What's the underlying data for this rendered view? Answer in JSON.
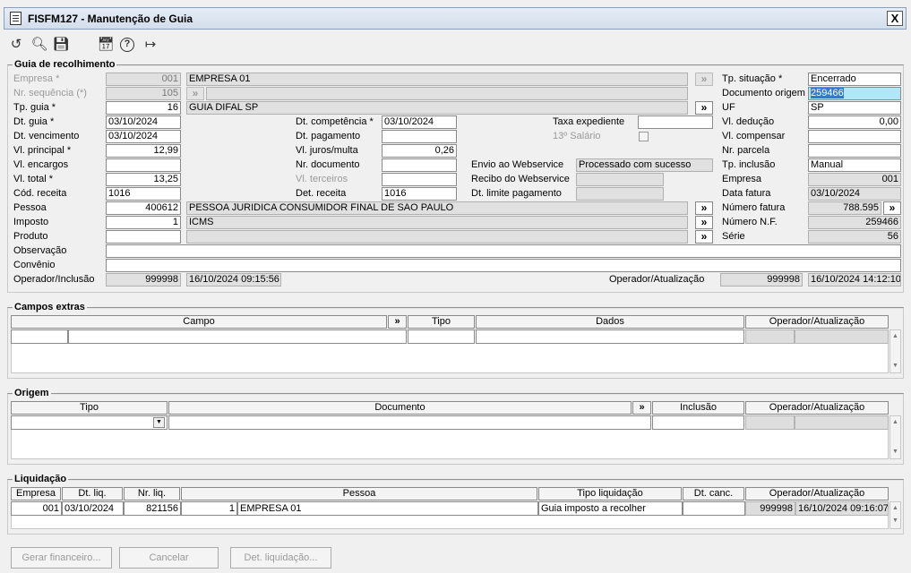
{
  "window": {
    "title": "FISFM127 - Manutenção de Guia",
    "close_label": "X"
  },
  "toolbar": {
    "undo": "↺",
    "search": "🔍︎",
    "save": "💾︎",
    "calendar": "📅︎",
    "help": "?",
    "exit": "↦"
  },
  "guia": {
    "legend": "Guia de recolhimento",
    "empresa": {
      "label": "Empresa *",
      "code": "001",
      "name": "EMPRESA 01"
    },
    "nr_sequencia": {
      "label": "Nr. sequência (*)",
      "value": "105"
    },
    "tp_guia": {
      "label": "Tp. guia *",
      "code": "16",
      "name": "GUIA DIFAL SP"
    },
    "dt_guia": {
      "label": "Dt. guia *",
      "value": "03/10/2024"
    },
    "dt_vencimento": {
      "label": "Dt. vencimento",
      "value": "03/10/2024"
    },
    "vl_principal": {
      "label": "Vl. principal *",
      "value": "12,99"
    },
    "vl_encargos": {
      "label": "Vl. encargos",
      "value": ""
    },
    "vl_total": {
      "label": "Vl. total *",
      "value": "13,25"
    },
    "cod_receita": {
      "label": "Cód. receita",
      "value": "1016"
    },
    "pessoa": {
      "label": "Pessoa",
      "code": "400612",
      "name": "PESSOA JURIDICA CONSUMIDOR FINAL DE SAO PAULO"
    },
    "imposto": {
      "label": "Imposto",
      "code": "1",
      "name": "ICMS"
    },
    "produto": {
      "label": "Produto",
      "code": "",
      "name": ""
    },
    "observacao": {
      "label": "Observação",
      "value": ""
    },
    "convenio": {
      "label": "Convênio",
      "value": ""
    },
    "operador_inclusao": {
      "label": "Operador/Inclusão",
      "code": "999998",
      "datetime": "16/10/2024 09:15:56"
    },
    "dt_competencia": {
      "label": "Dt. competência *",
      "value": "03/10/2024"
    },
    "dt_pagamento": {
      "label": "Dt. pagamento",
      "value": ""
    },
    "vl_juros_multa": {
      "label": "Vl. juros/multa",
      "value": "0,26"
    },
    "nr_documento": {
      "label": "Nr. documento",
      "value": ""
    },
    "vl_terceiros": {
      "label": "Vl. terceiros",
      "value": ""
    },
    "det_receita": {
      "label": "Det. receita",
      "value": "1016"
    },
    "taxa_expediente": {
      "label": "Taxa expediente",
      "value": ""
    },
    "decimo_terceiro": {
      "label": "13º Salário"
    },
    "envio_webservice": {
      "label": "Envio ao Webservice",
      "value": "Processado com sucesso"
    },
    "recibo_webservice": {
      "label": "Recibo do Webservice",
      "value": ""
    },
    "dt_limite_pagamento": {
      "label": "Dt. limite pagamento",
      "value": ""
    },
    "tp_situacao": {
      "label": "Tp. situação *",
      "value": "Encerrado"
    },
    "documento_origem": {
      "label": "Documento origem",
      "value": "259466"
    },
    "uf": {
      "label": "UF",
      "value": "SP"
    },
    "vl_deducao": {
      "label": "Vl. dedução",
      "value": "0,00"
    },
    "vl_compensar": {
      "label": "Vl. compensar",
      "value": ""
    },
    "nr_parcela": {
      "label": "Nr. parcela",
      "value": ""
    },
    "tp_inclusao": {
      "label": "Tp. inclusão",
      "value": "Manual"
    },
    "empresa_right": {
      "label": "Empresa",
      "value": "001"
    },
    "data_fatura": {
      "label": "Data fatura",
      "value": "03/10/2024"
    },
    "numero_fatura": {
      "label": "Número fatura",
      "value": "788.595"
    },
    "numero_nf": {
      "label": "Número N.F.",
      "value": "259466"
    },
    "serie": {
      "label": "Série",
      "value": "56"
    },
    "operador_atualizacao": {
      "label": "Operador/Atualização",
      "code": "999998",
      "datetime": "16/10/2024 14:12:10"
    },
    "lookup": "»"
  },
  "campos_extras": {
    "legend": "Campos extras",
    "headers": {
      "campo": "Campo",
      "lookup": "»",
      "tipo": "Tipo",
      "dados": "Dados",
      "operador": "Operador/Atualização"
    }
  },
  "origem": {
    "legend": "Origem",
    "headers": {
      "tipo": "Tipo",
      "documento": "Documento",
      "lookup": "»",
      "inclusao": "Inclusão",
      "operador": "Operador/Atualização"
    }
  },
  "liquidacao": {
    "legend": "Liquidação",
    "headers": {
      "empresa": "Empresa",
      "dt_liq": "Dt. liq.",
      "nr_liq": "Nr. liq.",
      "pessoa": "Pessoa",
      "tipo_liquidacao": "Tipo liquidação",
      "dt_canc": "Dt. canc.",
      "operador": "Operador/Atualização"
    },
    "row": {
      "empresa": "001",
      "dt_liq": "03/10/2024",
      "nr_liq": "821156",
      "pessoa_code": "1",
      "pessoa_name": "EMPRESA 01",
      "tipo_liquidacao": "Guia imposto a recolher",
      "dt_canc": "",
      "operador_code": "999998",
      "operador_datetime": "16/10/2024 09:16:07"
    }
  },
  "buttons": {
    "gerar_financeiro": "Gerar financeiro...",
    "cancelar": "Cancelar",
    "det_liquidacao": "Det. liquidação..."
  }
}
